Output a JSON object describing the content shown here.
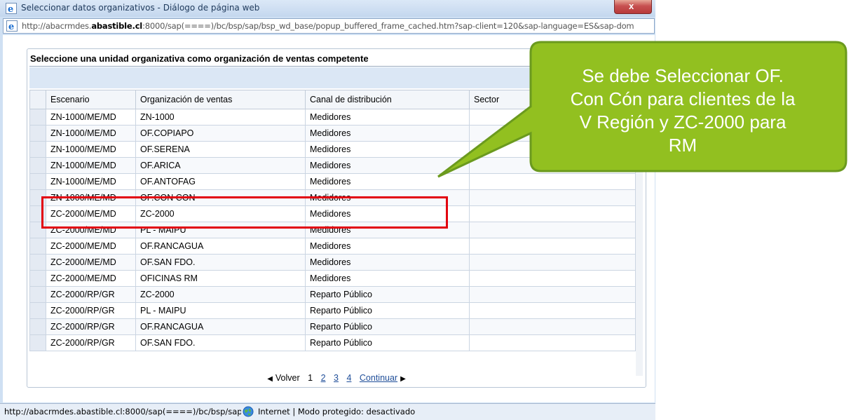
{
  "window": {
    "title": "Seleccionar datos organizativos - Diálogo de página web",
    "close_label": "x"
  },
  "address": {
    "prefix": "http://abacrmdes.",
    "host_bold": "abastible.cl",
    "suffix": ":8000/sap(====)/bc/bsp/sap/bsp_wd_base/popup_buffered_frame_cached.htm?sap-client=120&sap-language=ES&sap-dom"
  },
  "panel": {
    "title": "Seleccione una unidad organizativa como organización de ventas competente"
  },
  "table": {
    "columns": [
      "Escenario",
      "Organización de ventas",
      "Canal de distribución",
      "Sector"
    ],
    "rows": [
      [
        "ZN-1000/ME/MD",
        "ZN-1000",
        "Medidores",
        ""
      ],
      [
        "ZN-1000/ME/MD",
        "OF.COPIAPO",
        "Medidores",
        ""
      ],
      [
        "ZN-1000/ME/MD",
        "OF.SERENA",
        "Medidores",
        ""
      ],
      [
        "ZN-1000/ME/MD",
        "OF.ARICA",
        "Medidores",
        ""
      ],
      [
        "ZN-1000/ME/MD",
        "OF.ANTOFAG",
        "Medidores",
        ""
      ],
      [
        "ZN-1000/ME/MD",
        "OF.CON CON",
        "Medidores",
        ""
      ],
      [
        "ZC-2000/ME/MD",
        "ZC-2000",
        "Medidores",
        ""
      ],
      [
        "ZC-2000/ME/MD",
        "PL - MAIPU",
        "Medidores",
        ""
      ],
      [
        "ZC-2000/ME/MD",
        "OF.RANCAGUA",
        "Medidores",
        ""
      ],
      [
        "ZC-2000/ME/MD",
        "OF.SAN FDO.",
        "Medidores",
        ""
      ],
      [
        "ZC-2000/ME/MD",
        "OFICINAS RM",
        "Medidores",
        ""
      ],
      [
        "ZC-2000/RP/GR",
        "ZC-2000",
        "Reparto Público",
        ""
      ],
      [
        "ZC-2000/RP/GR",
        "PL - MAIPU",
        "Reparto Público",
        ""
      ],
      [
        "ZC-2000/RP/GR",
        "OF.RANCAGUA",
        "Reparto Público",
        ""
      ],
      [
        "ZC-2000/RP/GR",
        "OF.SAN FDO.",
        "Reparto Público",
        ""
      ]
    ]
  },
  "pager": {
    "back_label": "Volver",
    "current_page": "1",
    "pages": [
      "2",
      "3",
      "4"
    ],
    "next_label": "Continuar"
  },
  "status": {
    "url": "http://abacrmdes.abastible.cl:8000/sap(====)/bc/bsp/sap/bsp",
    "zone": "Internet | Modo protegido: desactivado"
  },
  "callout": {
    "lines": [
      "Se debe Seleccionar  OF.",
      "Con Cón para clientes de la",
      "V Región y ZC-2000 para",
      "RM"
    ],
    "fill_color": "#92c020",
    "border_color": "#6b9a1e"
  },
  "highlight": {
    "color": "#e2000f"
  },
  "icons": {
    "title": "ie-icon",
    "address": "ie-icon",
    "status": "globe-icon"
  }
}
